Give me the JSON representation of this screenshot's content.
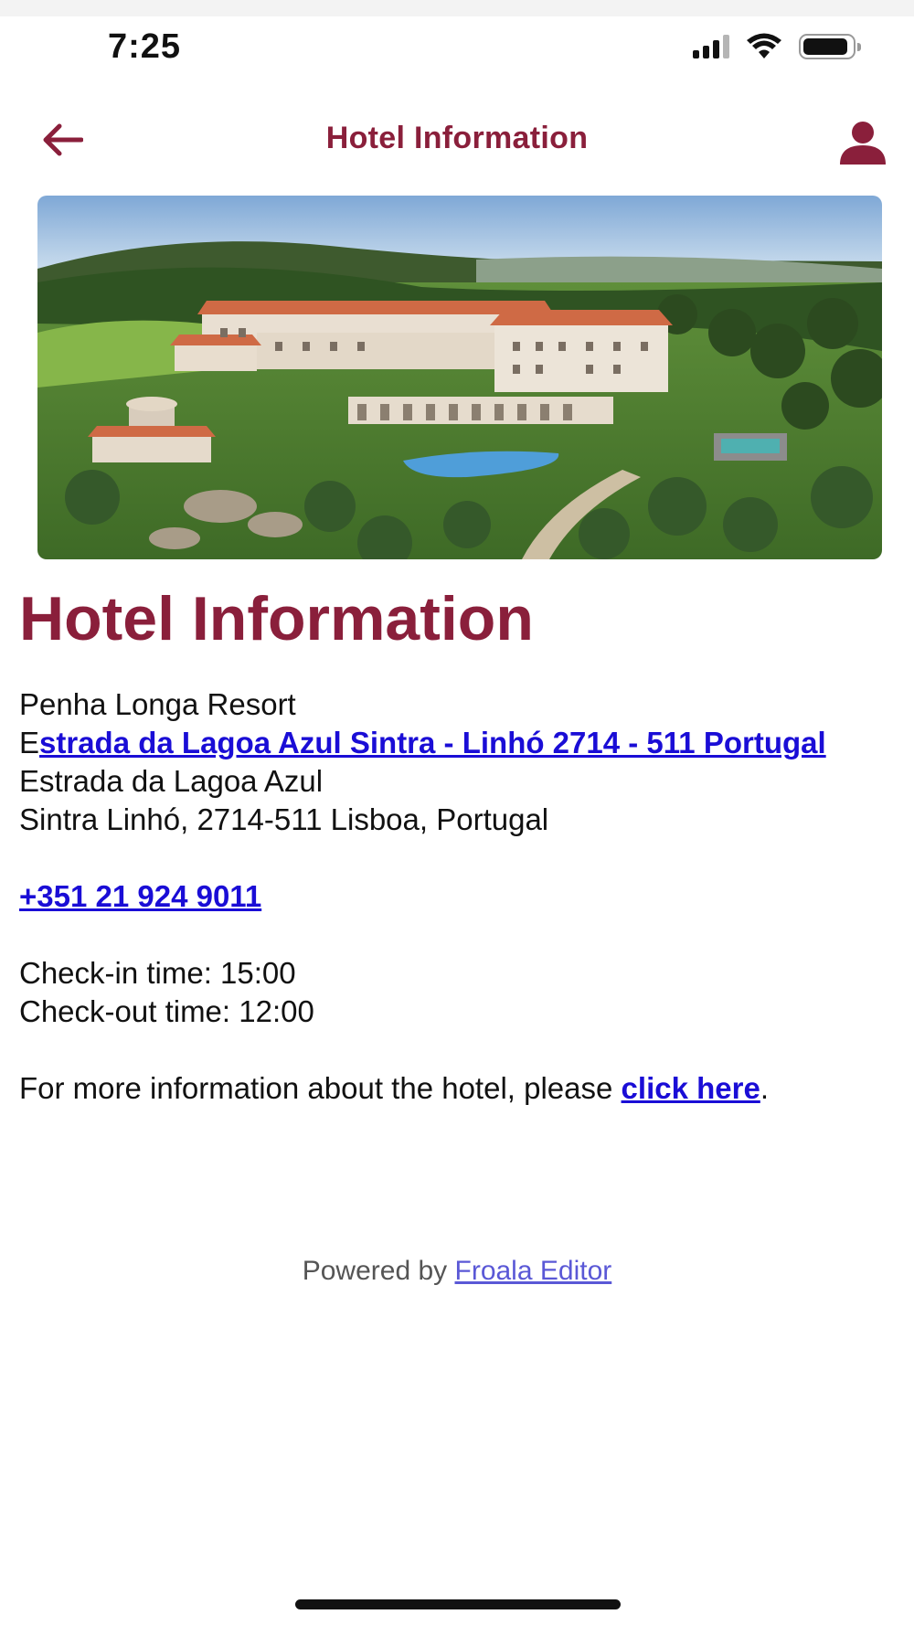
{
  "status_bar": {
    "time": "7:25"
  },
  "nav": {
    "title": "Hotel Information",
    "back_icon": "arrow-left-icon",
    "profile_icon": "user-icon",
    "accent_color": "#8a1f3b"
  },
  "hero": {
    "image": "hotel-resort-aerial-photo"
  },
  "content": {
    "heading": "Hotel Information",
    "resort_name": "Penha Longa Resort",
    "address_link_first": "E",
    "address_link_rest": "strada da Lagoa Azul Sintra - Linhó 2714 - 511 Portugal",
    "address_line1": "Estrada da Lagoa Azul",
    "address_line2": "Sintra Linhó, 2714-511 Lisboa, Portugal",
    "phone": "+351 21 924 9011",
    "checkin": "Check-in time: 15:00",
    "checkout": "Check-out time: 12:00",
    "more_info_prefix": "For more information about the hotel, please ",
    "more_info_link": "click here",
    "more_info_suffix": "."
  },
  "footer": {
    "powered_prefix": "Powered by ",
    "powered_link": "Froala Editor"
  }
}
